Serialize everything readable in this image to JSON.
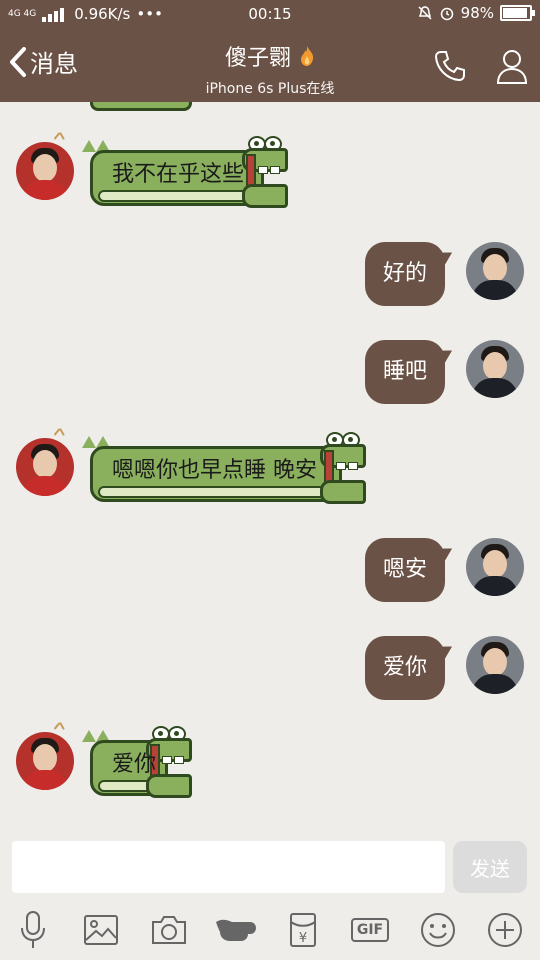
{
  "status_bar": {
    "network": "4G 4G",
    "speed": "0.96K/s",
    "dots": "•••",
    "time": "00:15",
    "battery": "98%",
    "battery_level": 0.98
  },
  "header": {
    "back_label": "消息",
    "title": "傻子翾",
    "subtitle": "iPhone 6s Plus在线"
  },
  "messages": [
    {
      "side": "left",
      "style": "croc",
      "text": "我不在乎这些"
    },
    {
      "side": "right",
      "style": "bubble",
      "text": "好的"
    },
    {
      "side": "right",
      "style": "bubble",
      "text": "睡吧"
    },
    {
      "side": "left",
      "style": "croc",
      "text": "嗯嗯你也早点睡 晚安"
    },
    {
      "side": "right",
      "style": "bubble",
      "text": "嗯安"
    },
    {
      "side": "right",
      "style": "bubble",
      "text": "爱你"
    },
    {
      "side": "left",
      "style": "croc",
      "text": "爱你"
    }
  ],
  "input": {
    "value": "",
    "placeholder": "",
    "send_label": "发送"
  },
  "toolbar": {
    "items": [
      "mic-icon",
      "image-icon",
      "camera-icon",
      "poke-icon",
      "red-packet-icon",
      "gif-icon",
      "emoji-icon",
      "plus-icon"
    ],
    "gif_label": "GIF",
    "red_packet_symbol": "¥"
  },
  "colors": {
    "header_bg": "#6b5246",
    "chat_bg": "#efedea",
    "croc_green": "#8ab05e",
    "right_bubble": "#6b5246"
  }
}
